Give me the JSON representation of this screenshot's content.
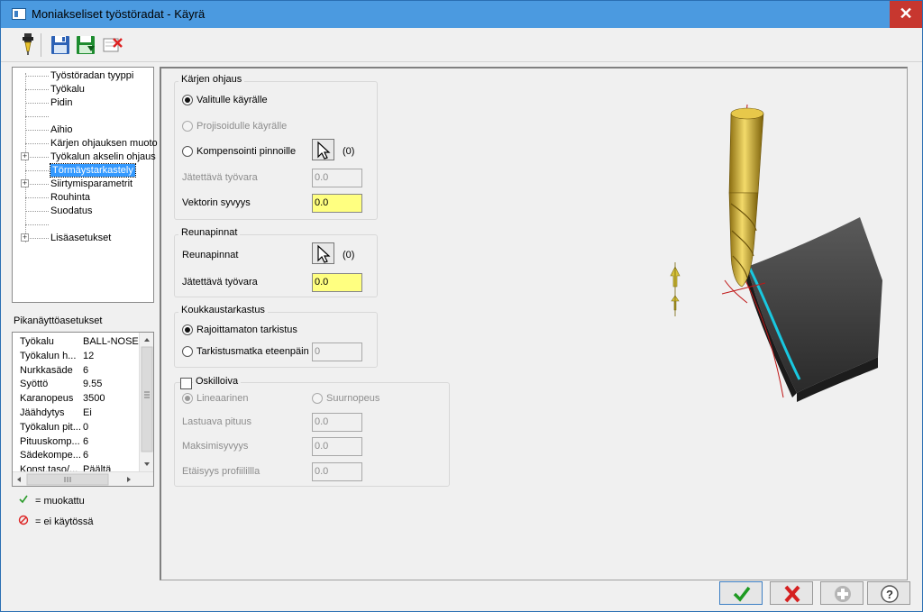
{
  "window": {
    "title": "Moniakseliset työstöradat - Käyrä",
    "close_label": "✕"
  },
  "toolbar": {
    "icons": [
      "tool-icon",
      "save-icon",
      "save-as-icon",
      "delete-icon"
    ]
  },
  "tree": {
    "items": [
      {
        "label": "Työstöradan tyyppi",
        "expandable": false
      },
      {
        "label": "Työkalu",
        "expandable": false
      },
      {
        "label": "Pidin",
        "expandable": false
      },
      {
        "label": "",
        "expandable": false
      },
      {
        "label": "Aihio",
        "expandable": false
      },
      {
        "label": "Kärjen ohjauksen muoto",
        "expandable": false
      },
      {
        "label": "Työkalun akselin ohjaus",
        "expandable": true
      },
      {
        "label": "Törmäystarkastelu",
        "expandable": false
      },
      {
        "label": "Siirtymisparametrit",
        "expandable": true
      },
      {
        "label": "Rouhinta",
        "expandable": false
      },
      {
        "label": "Suodatus",
        "expandable": false
      },
      {
        "label": "",
        "expandable": false
      },
      {
        "label": "Lisäasetukset",
        "expandable": true
      }
    ],
    "selected_label": "Törmäystarkastely"
  },
  "quick_settings": {
    "title": "Pikanäyttöasetukset",
    "rows": [
      {
        "key": "Työkalu",
        "value": "BALL-NOSE ..."
      },
      {
        "key": "Työkalun h...",
        "value": "12"
      },
      {
        "key": "Nurkkasäde",
        "value": "6"
      },
      {
        "key": "Syöttö",
        "value": "9.55"
      },
      {
        "key": "Karanopeus",
        "value": "3500"
      },
      {
        "key": "Jäähdytys",
        "value": "Ei"
      },
      {
        "key": "Työkalun pit...",
        "value": "0"
      },
      {
        "key": "Pituuskomp...",
        "value": "6"
      },
      {
        "key": "Sädekompe...",
        "value": "6"
      },
      {
        "key": "Konst.taso/...",
        "value": "Päältä"
      }
    ]
  },
  "legend": {
    "modified": "= muokattu",
    "disabled": "= ei käytössä"
  },
  "tip_control": {
    "title": "Kärjen ohjaus",
    "opt_selected_curve": "Valitulle käyrälle",
    "opt_projected_curve": "Projisoidulle käyrälle",
    "opt_compensation": "Kompensointi pinnoille",
    "compensation_count": "(0)",
    "stock_label": "Jätettävä työvara",
    "stock_value": "0.0",
    "vector_depth_label": "Vektorin syvyys",
    "vector_depth_value": "0.0"
  },
  "edge_surfaces": {
    "title": "Reunapinnat",
    "label": "Reunapinnat",
    "count": "(0)",
    "stock_label": "Jätettävä työvara",
    "stock_value": "0.0"
  },
  "gouge_check": {
    "title": "Koukkaustarkastus",
    "opt_unlimited": "Rajoittamaton tarkistus",
    "opt_lookahead": "Tarkistusmatka eteenpäin",
    "lookahead_value": "0"
  },
  "oscillate": {
    "title": "Oskilloiva",
    "opt_linear": "Lineaarinen",
    "opt_high_speed": "Suurnopeus",
    "cut_length_label": "Lastuava pituus",
    "cut_length_value": "0.0",
    "max_depth_label": "Maksimisyvyys",
    "max_depth_value": "0.0",
    "profile_distance_label": "Etäisyys profiilillla",
    "profile_distance_value": "0.0"
  },
  "buttons": [
    "ok-icon",
    "cancel-icon",
    "apply-icon",
    "help-icon"
  ],
  "colors": {
    "titlebar": "#4b9ae0",
    "close": "#c7372f",
    "highlight_field": "#ffff80",
    "selection": "#3399ff"
  }
}
